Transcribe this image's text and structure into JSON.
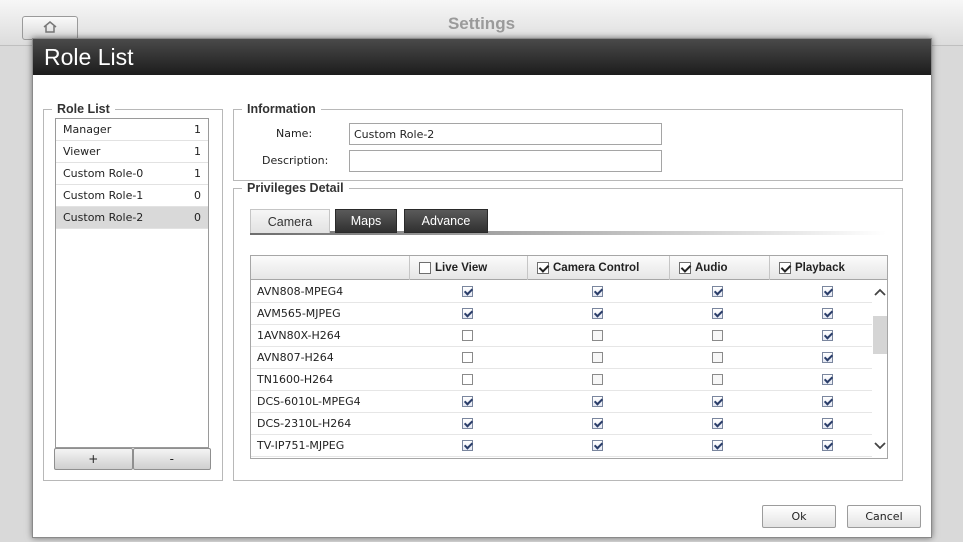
{
  "background_window": {
    "title": "Settings",
    "home_icon": "home-icon"
  },
  "dialog": {
    "title": "Role List"
  },
  "role_list": {
    "legend": "Role List",
    "roles": [
      {
        "name": "Manager",
        "count": "1"
      },
      {
        "name": "Viewer",
        "count": "1"
      },
      {
        "name": "Custom Role-0",
        "count": "1"
      },
      {
        "name": "Custom Role-1",
        "count": "0"
      },
      {
        "name": "Custom Role-2",
        "count": "0"
      }
    ],
    "selected_index": 4,
    "add_label": "+",
    "remove_label": "-"
  },
  "information": {
    "legend": "Information",
    "name_label": "Name:",
    "name_value": "Custom Role-2",
    "description_label": "Description:",
    "description_value": ""
  },
  "privileges": {
    "legend": "Privileges Detail",
    "tabs": [
      {
        "label": "Camera",
        "active": true
      },
      {
        "label": "Maps",
        "active": false
      },
      {
        "label": "Advance",
        "active": false
      }
    ],
    "columns": [
      {
        "label": "Live View",
        "checked": false
      },
      {
        "label": "Camera Control",
        "checked": true
      },
      {
        "label": "Audio",
        "checked": true
      },
      {
        "label": "Playback",
        "checked": true
      }
    ],
    "rows": [
      {
        "name": "AVN808-MPEG4",
        "live": "checked",
        "control": "checked",
        "audio": "checked",
        "playback": "checked"
      },
      {
        "name": "AVM565-MJPEG",
        "live": "checked",
        "control": "checked",
        "audio": "checked",
        "playback": "checked"
      },
      {
        "name": "1AVN80X-H264",
        "live": "unchecked",
        "control": "disabled",
        "audio": "disabled",
        "playback": "checked"
      },
      {
        "name": "AVN807-H264",
        "live": "unchecked",
        "control": "disabled",
        "audio": "disabled",
        "playback": "checked"
      },
      {
        "name": "TN1600-H264",
        "live": "unchecked",
        "control": "disabled",
        "audio": "disabled",
        "playback": "checked"
      },
      {
        "name": "DCS-6010L-MPEG4",
        "live": "checked",
        "control": "checked",
        "audio": "checked",
        "playback": "checked"
      },
      {
        "name": "DCS-2310L-H264",
        "live": "checked",
        "control": "checked",
        "audio": "checked",
        "playback": "checked"
      },
      {
        "name": "TV-IP751-MJPEG",
        "live": "checked",
        "control": "checked",
        "audio": "checked",
        "playback": "checked"
      }
    ],
    "scroll_up_icon": "chevron-up-icon",
    "scroll_down_icon": "chevron-down-icon"
  },
  "footer": {
    "ok_label": "Ok",
    "cancel_label": "Cancel"
  },
  "colors": {
    "header_dark": "#1c1c1c",
    "selected_row": "#d9d9d9",
    "overlay": "#6e6e6e"
  }
}
